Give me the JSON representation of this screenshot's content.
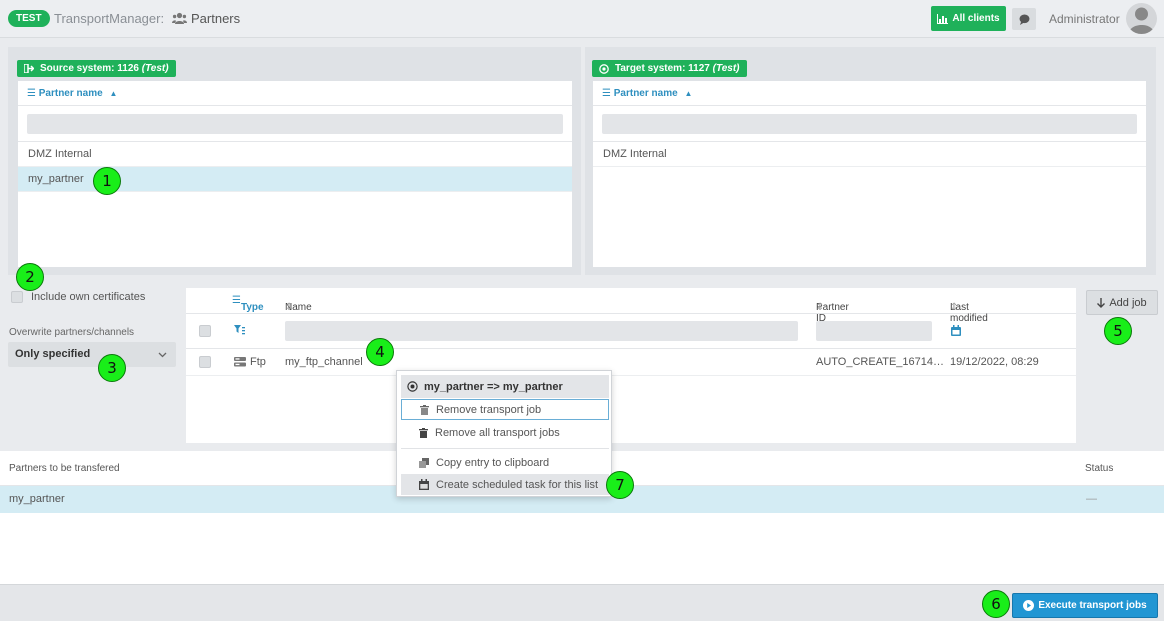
{
  "header": {
    "env_badge": "TEST",
    "app_title": "TransportManager:",
    "page_title": "Partners",
    "all_clients_label": "All clients",
    "user_name": "Administrator"
  },
  "source": {
    "label": "Source system: 1126",
    "env": "(Test)",
    "column_header": "Partner name",
    "rows": [
      "DMZ Internal",
      "my_partner"
    ]
  },
  "target": {
    "label": "Target system: 1127",
    "env": "(Test)",
    "column_header": "Partner name",
    "rows": [
      "DMZ Internal"
    ]
  },
  "options": {
    "include_certificates_label": "Include own certificates",
    "overwrite_label": "Overwrite partners/channels",
    "overwrite_value": "Only specified"
  },
  "jobs": {
    "columns": {
      "type": "Type",
      "name": "Name",
      "partner_id": "Partner ID",
      "last_modified": "Last modified"
    },
    "rows": [
      {
        "type": "Ftp",
        "name": "my_ftp_channel",
        "partner_id": "AUTO_CREATE_16714…",
        "last_modified": "19/12/2022, 08:29"
      }
    ],
    "add_job_label": "Add job"
  },
  "transfer": {
    "col_partners": "Partners to be transfered",
    "col_status": "Status",
    "rows": [
      {
        "partner": "my_partner",
        "status": "—"
      }
    ]
  },
  "footer": {
    "execute_label": "Execute transport jobs"
  },
  "context_menu": {
    "title": "my_partner => my_partner",
    "items": [
      "Remove transport job",
      "Remove all transport jobs",
      "Copy entry to clipboard",
      "Create scheduled task for this list"
    ]
  },
  "callouts": [
    "1",
    "2",
    "3",
    "4",
    "5",
    "6",
    "7"
  ],
  "colors": {
    "green": "#1fb15a",
    "blue": "#2196d3",
    "selection": "#d4ecf4",
    "callout": "#19ee19"
  }
}
